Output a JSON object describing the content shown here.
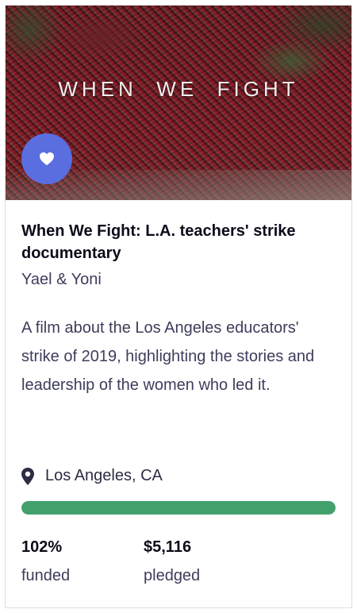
{
  "project": {
    "hero_title": "WHEN  WE  FIGHT",
    "title": "When We Fight: L.A. teachers' strike documentary",
    "creator": "Yael & Yoni",
    "blurb": "A film about the Los Angeles educators' strike of 2019, highlighting the stories and leadership of the women who led it.",
    "location": "Los Angeles, CA",
    "progress_fraction": 1.0,
    "stats": {
      "funded_value": "102%",
      "funded_label": "funded",
      "pledged_value": "$5,116",
      "pledged_label": "pledged"
    }
  },
  "icons": {
    "favorite": "heart-icon",
    "location": "map-pin-icon"
  },
  "colors": {
    "favorite_button": "#5a6ee0",
    "progress_fill": "#41a06c",
    "progress_track": "#e3e3ea",
    "title_text": "#0b0b1a",
    "body_text": "#3d3d5c"
  }
}
